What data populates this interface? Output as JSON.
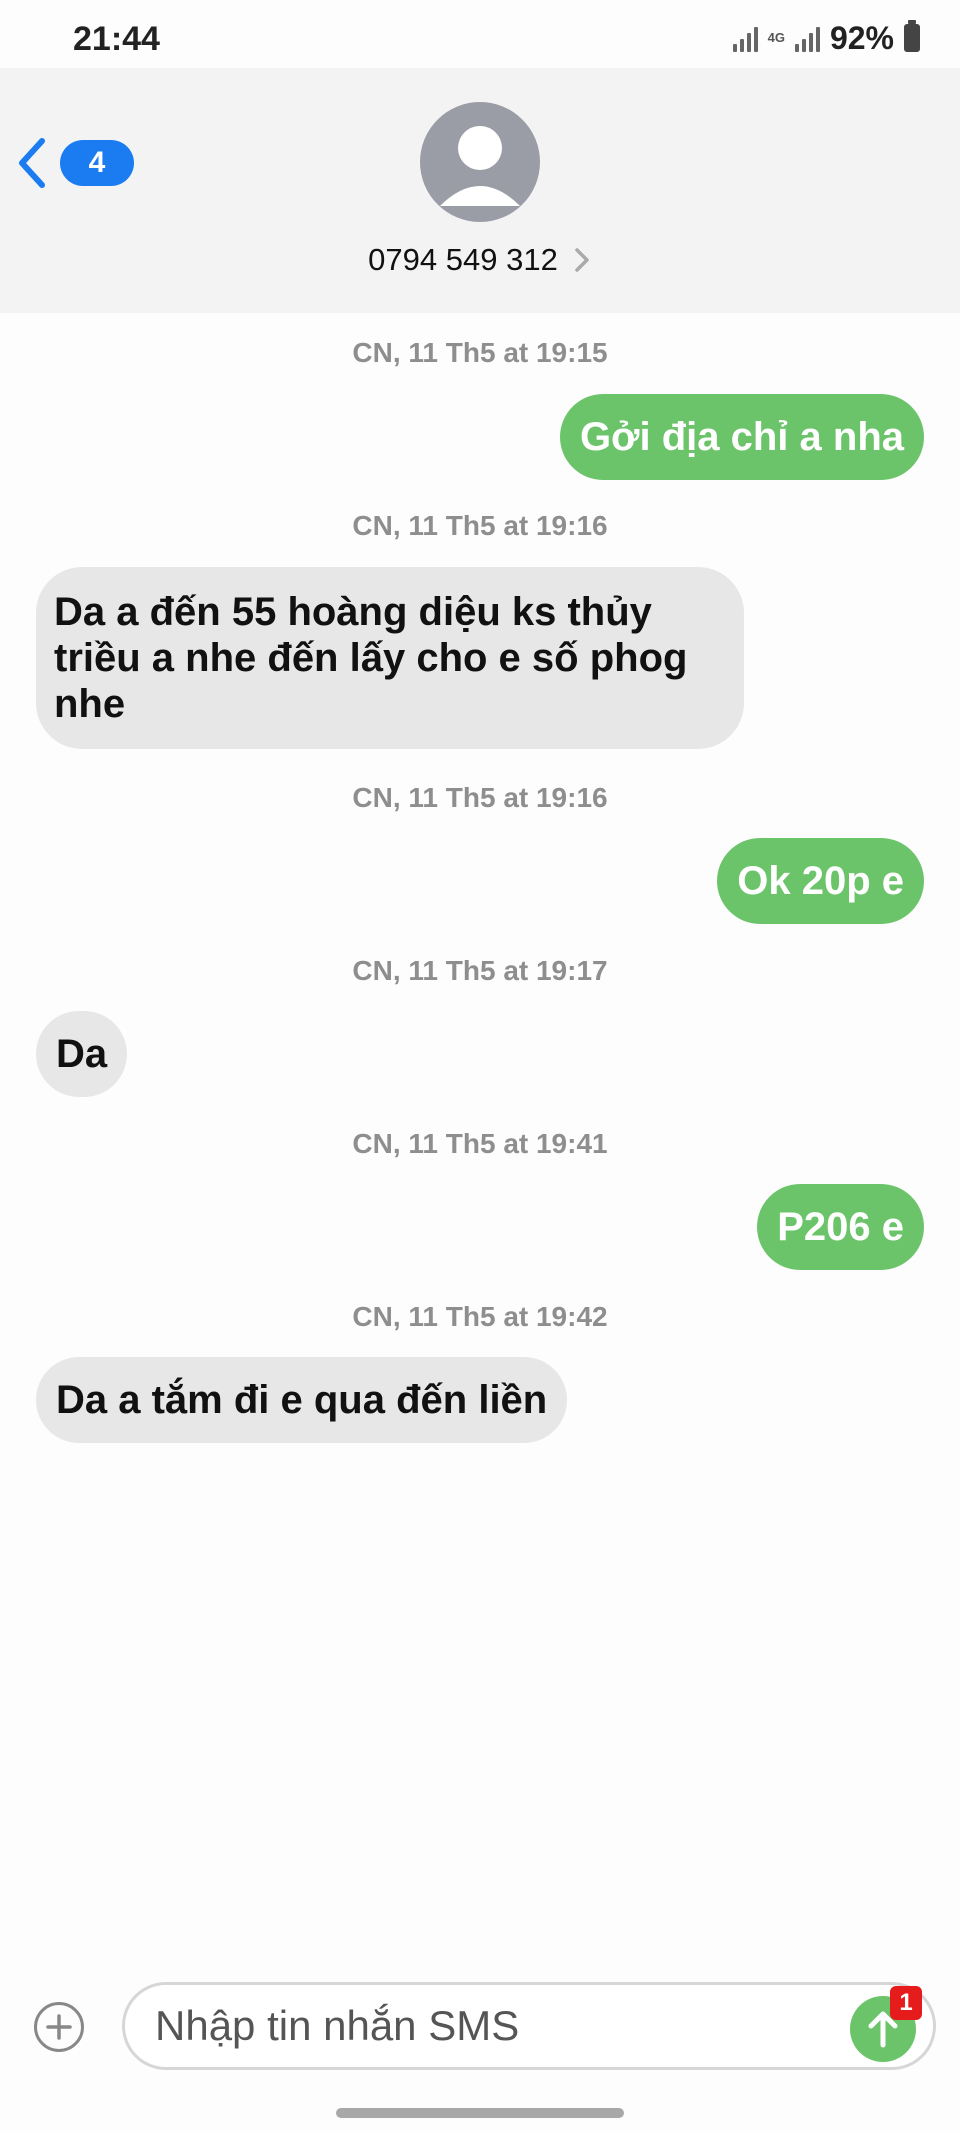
{
  "status_bar": {
    "time": "21:44",
    "network": "4G",
    "battery": "92%"
  },
  "header": {
    "unread_count": "4",
    "contact": "0794 549 312"
  },
  "thread": {
    "items": [
      {
        "timestamp": "CN, 11 Th5 at 19:15",
        "direction": "out",
        "text": "Gởi địa chỉ a nha"
      },
      {
        "timestamp": "CN, 11 Th5 at 19:16",
        "direction": "in",
        "text": "Da a đến 55 hoàng diệu ks thủy triều a nhe đến lấy cho e số phog nhe"
      },
      {
        "timestamp": "CN, 11 Th5 at 19:16",
        "direction": "out",
        "text": "Ok 20p e"
      },
      {
        "timestamp": "CN, 11 Th5 at 19:17",
        "direction": "in",
        "text": "Da"
      },
      {
        "timestamp": "CN, 11 Th5 at 19:41",
        "direction": "out",
        "text": "P206 e"
      },
      {
        "timestamp": "CN, 11 Th5 at 19:42",
        "direction": "in",
        "text": "Da a tắm đi e qua đến liền"
      }
    ]
  },
  "composer": {
    "placeholder": "Nhập tin nhắn SMS",
    "value": "",
    "send_badge": "1"
  },
  "colors": {
    "outgoing_bubble": "#6cc46a",
    "incoming_bubble": "#e7e7e7",
    "accent_blue": "#1a7cf0",
    "badge_red": "#e61c1c"
  },
  "icons": [
    "back-chevron-icon",
    "avatar-person-icon",
    "contact-chevron-icon",
    "signal-icon",
    "battery-icon",
    "plus-icon",
    "send-arrow-icon"
  ]
}
